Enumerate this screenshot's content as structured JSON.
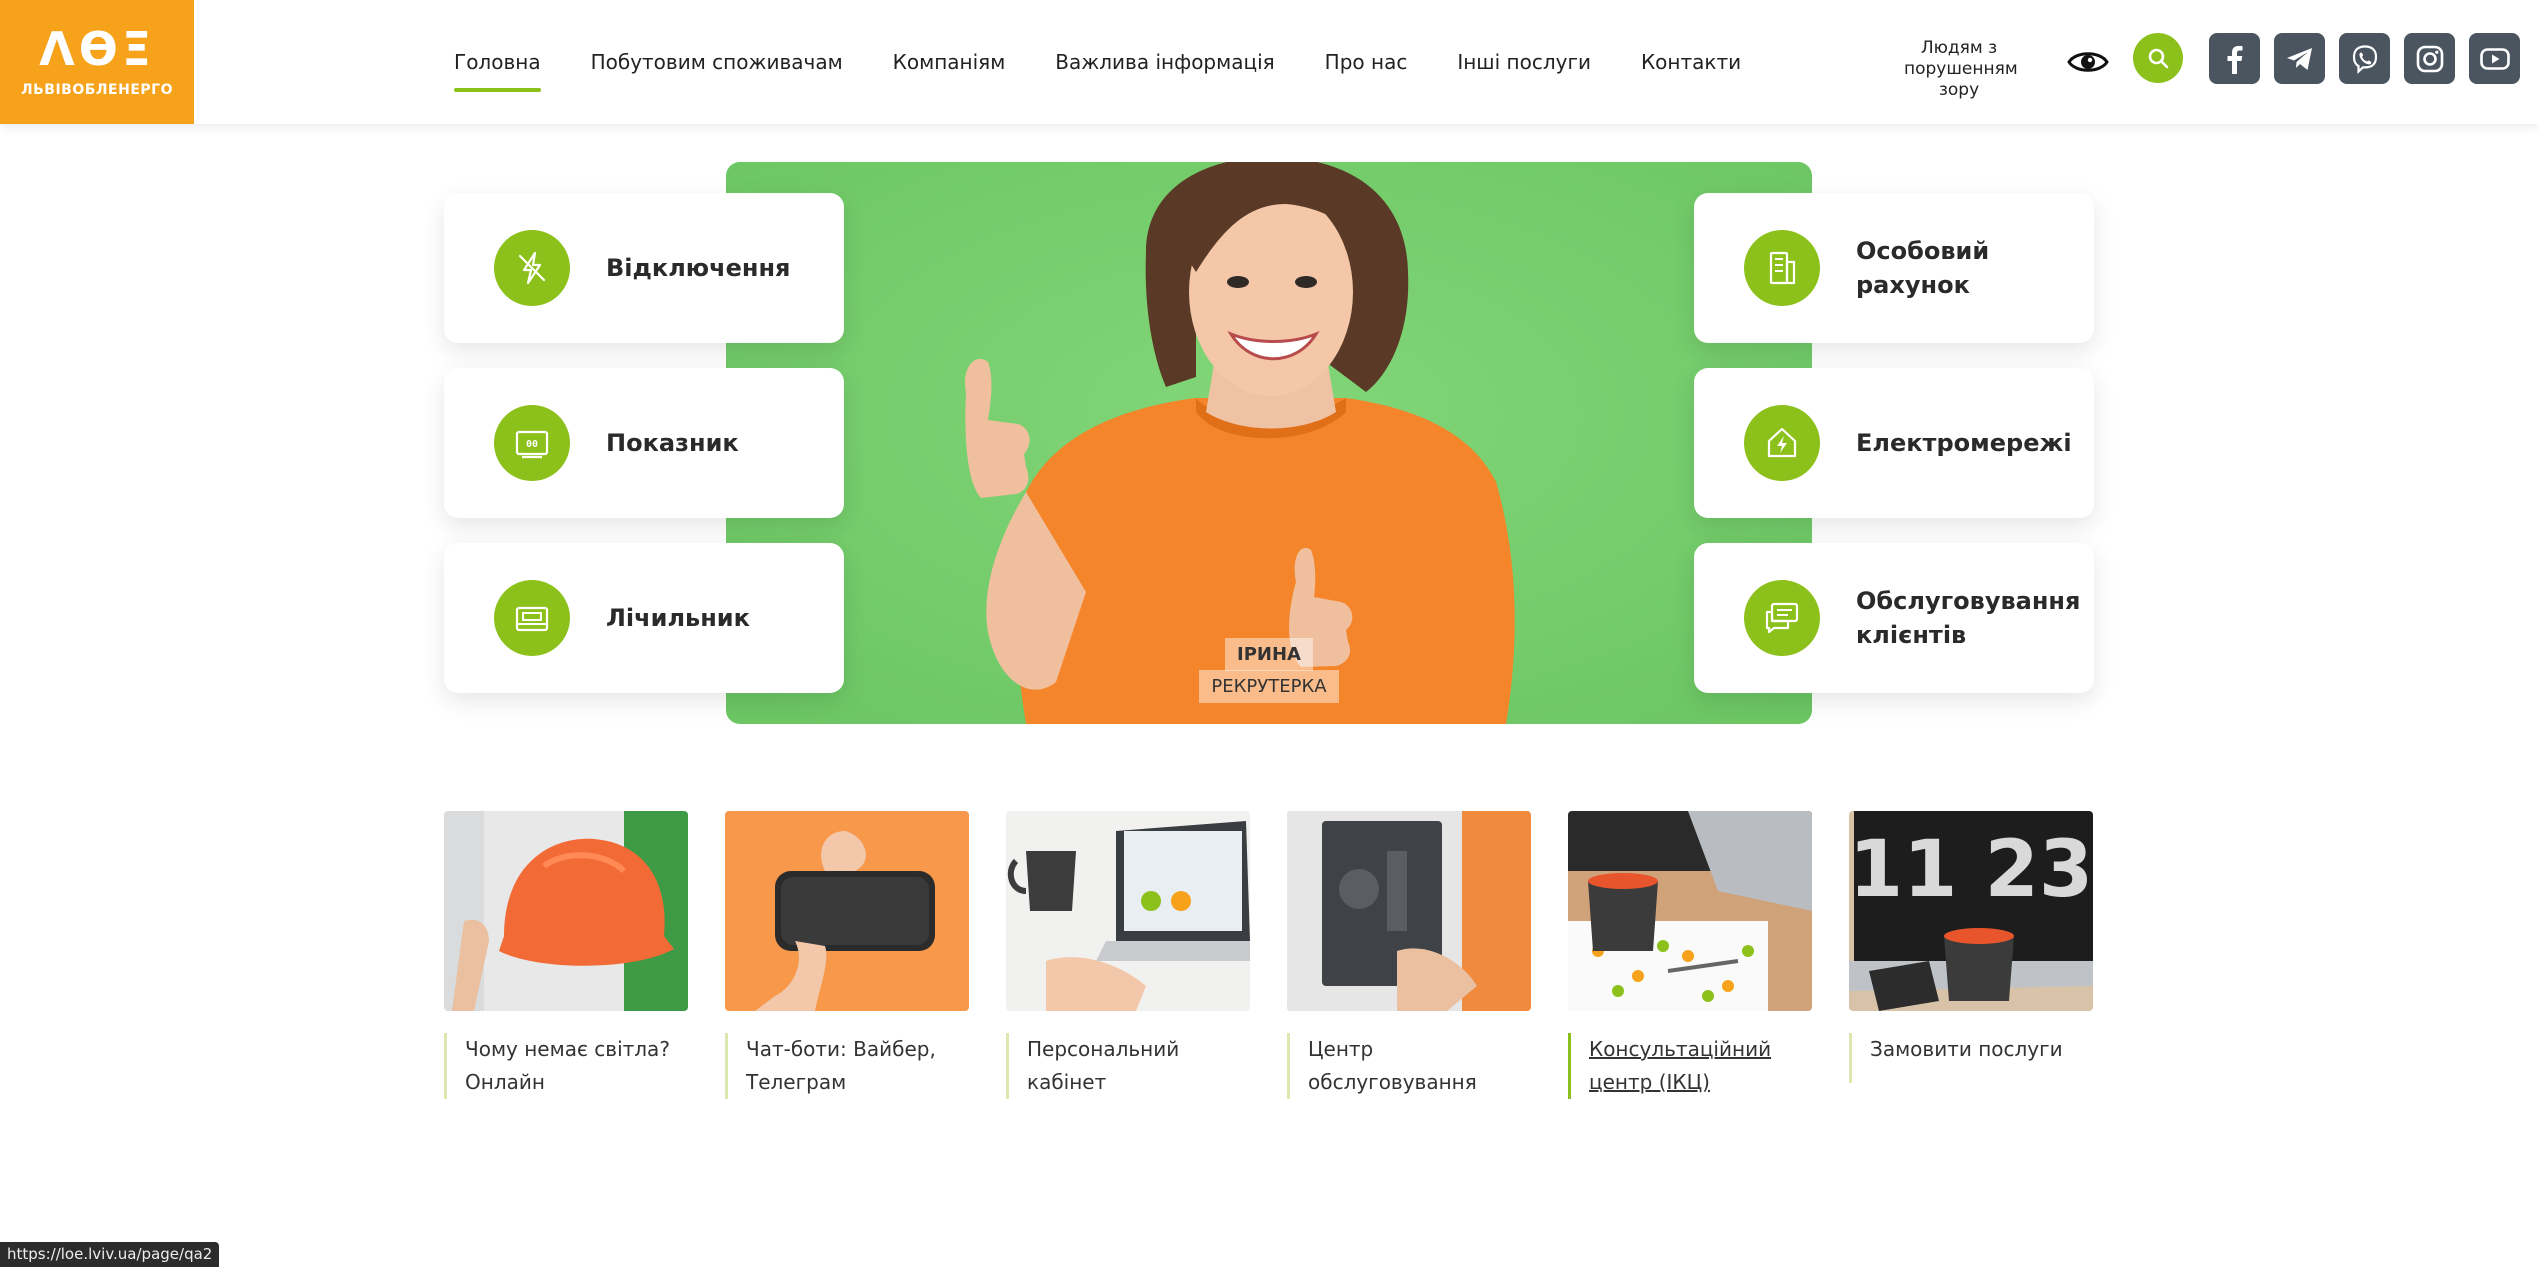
{
  "brand": {
    "mark": "ΛϴΞ",
    "name": "ЛЬВІВОБЛЕНЕРГО",
    "color": "#f7a21b",
    "accent": "#8cc01a"
  },
  "nav": [
    {
      "label": "Головна",
      "active": true
    },
    {
      "label": "Побутовим споживачам"
    },
    {
      "label": "Компаніям"
    },
    {
      "label": "Важлива інформація"
    },
    {
      "label": "Про нас"
    },
    {
      "label": "Інші послуги"
    },
    {
      "label": "Контакти"
    }
  ],
  "header": {
    "vision_label": "Людям з порушенням зору",
    "vision_icon": "eye-icon",
    "search_icon": "search-icon",
    "socials": [
      "facebook-icon",
      "telegram-icon",
      "viber-icon",
      "instagram-icon",
      "youtube-icon"
    ]
  },
  "hero": {
    "name": "ІРИНА",
    "role": "РЕКРУТЕРКА",
    "cards_left": [
      {
        "label": "Відключення",
        "icon": "power-outage-icon"
      },
      {
        "label": "Показник",
        "icon": "meter-reading-icon"
      },
      {
        "label": "Лічильник",
        "icon": "electric-meter-icon"
      }
    ],
    "cards_right": [
      {
        "label": "Особовий рахунок",
        "icon": "account-document-icon"
      },
      {
        "label": "Електромережі",
        "icon": "power-grid-icon"
      },
      {
        "label": "Обслуговування клієнтів",
        "icon": "chat-icon"
      }
    ]
  },
  "tiles": [
    {
      "label": "Чому немає світла? Онлайн",
      "image": "hard-hat"
    },
    {
      "label": "Чат-боти: Вайбер, Телеграм",
      "image": "smartphone"
    },
    {
      "label": "Персональний кабінет",
      "image": "laptop-cup"
    },
    {
      "label": "Центр обслуговування",
      "image": "notebook"
    },
    {
      "label": "Консультаційний центр (ІКЦ)",
      "image": "cup-laptop",
      "highlighted": true
    },
    {
      "label": "Замовити послуги",
      "image": "clock-cup"
    }
  ],
  "status_url": "https://loe.lviv.ua/page/qa2"
}
